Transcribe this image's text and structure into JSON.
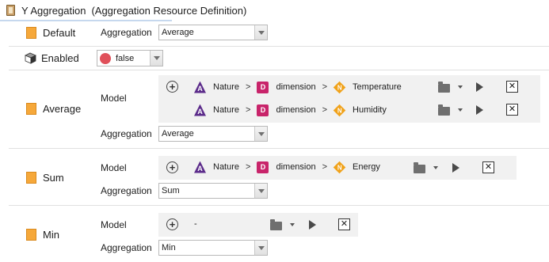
{
  "header": {
    "title": "Y Aggregation",
    "subtitle": "(Aggregation Resource Definition)"
  },
  "default": {
    "label": "Default",
    "aggregation_label": "Aggregation",
    "aggregation_value": "Average"
  },
  "enabled": {
    "label": "Enabled",
    "value": "false"
  },
  "sections": [
    {
      "label": "Average",
      "model_label": "Model",
      "aggregation_label": "Aggregation",
      "aggregation_value": "Average",
      "rows": [
        {
          "nature": "Nature",
          "dimension": "dimension",
          "measure": "Temperature"
        },
        {
          "nature": "Nature",
          "dimension": "dimension",
          "measure": "Humidity"
        }
      ]
    },
    {
      "label": "Sum",
      "model_label": "Model",
      "aggregation_label": "Aggregation",
      "aggregation_value": "Sum",
      "rows": [
        {
          "nature": "Nature",
          "dimension": "dimension",
          "measure": "Energy"
        }
      ]
    },
    {
      "label": "Min",
      "model_label": "Model",
      "aggregation_label": "Aggregation",
      "aggregation_value": "Min",
      "rows": [
        {
          "empty": "-"
        }
      ]
    }
  ],
  "symbols": {
    "separator": ">",
    "badge_a": "A",
    "badge_d": "D",
    "badge_n": "N",
    "plus": "+",
    "x": "✕"
  },
  "colors": {
    "slot_icon": "#f6a83a",
    "false_dot": "#e0505a",
    "badge_a": "#5b2b8a",
    "badge_d": "#c8246a",
    "badge_n": "#f0a21a",
    "model_bg": "#f1f1f1"
  }
}
